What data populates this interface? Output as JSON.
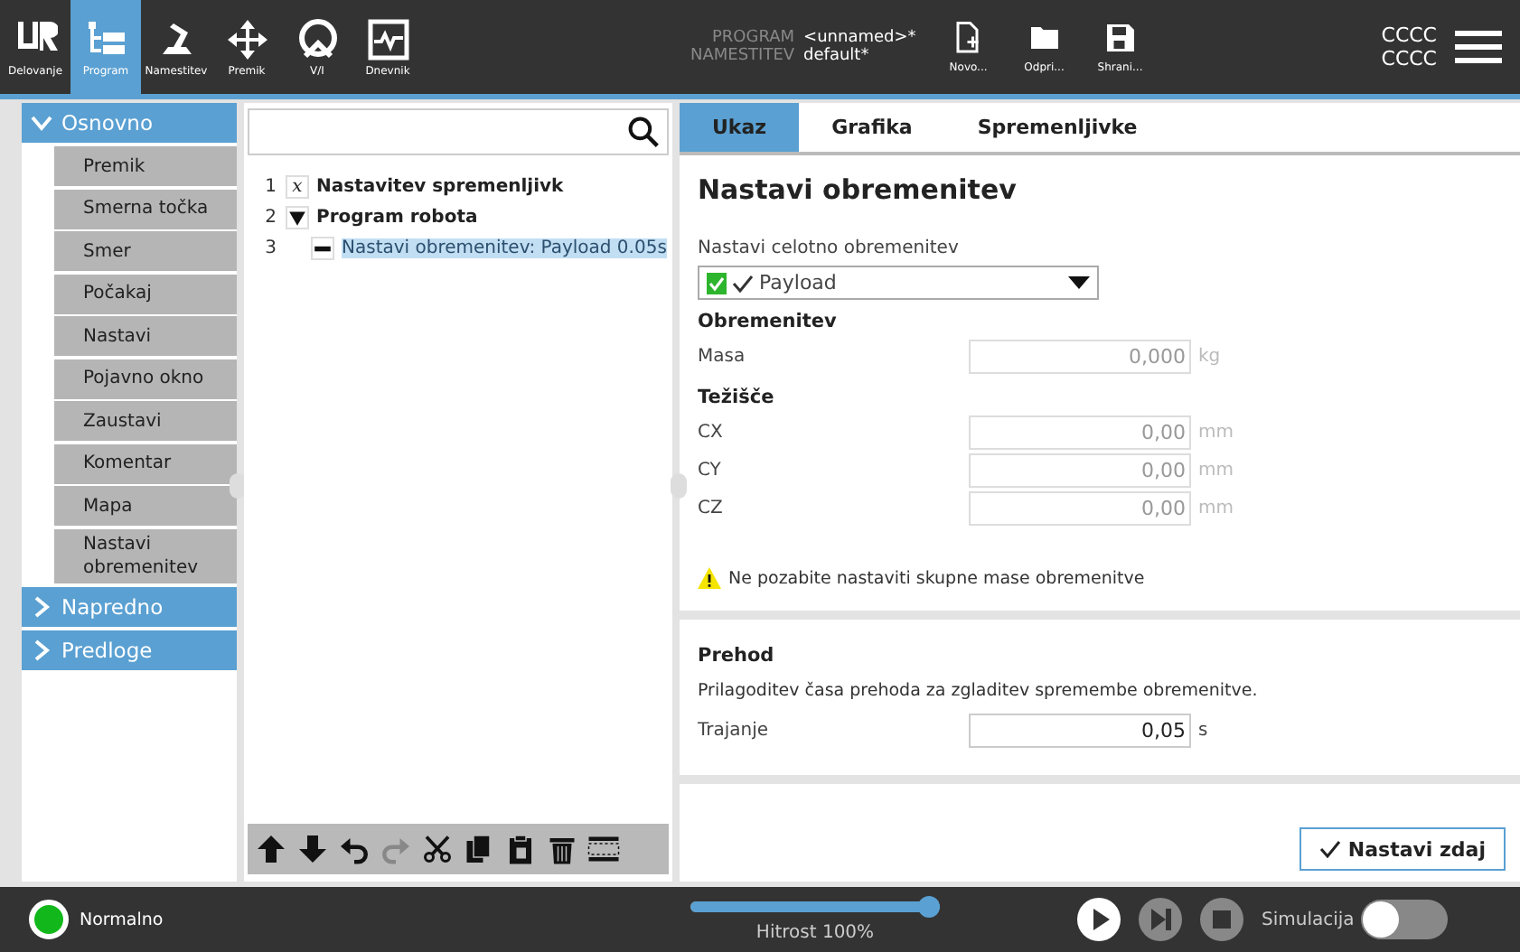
{
  "header": {
    "nav": [
      {
        "label": "Delovanje",
        "selected": false
      },
      {
        "label": "Program",
        "selected": true
      },
      {
        "label": "Namestitev",
        "selected": false
      },
      {
        "label": "Premik",
        "selected": false
      },
      {
        "label": "V/I",
        "selected": false
      },
      {
        "label": "Dnevnik",
        "selected": false
      }
    ],
    "program_label": "PROGRAM",
    "program_name": "<unnamed>*",
    "installation_label": "NAMESTITEV",
    "installation_name": "default*",
    "file_buttons": [
      "Novo...",
      "Odpri...",
      "Shrani..."
    ],
    "user_lines": [
      "CCCC",
      "CCCC"
    ]
  },
  "sidebar": {
    "groups": [
      {
        "label": "Osnovno",
        "expanded": true,
        "items": [
          "Premik",
          "Smerna točka",
          "Smer",
          "Počakaj",
          "Nastavi",
          "Pojavno okno",
          "Zaustavi",
          "Komentar",
          "Mapa",
          "Nastavi obremenitev"
        ]
      },
      {
        "label": "Napredno",
        "expanded": false
      },
      {
        "label": "Predloge",
        "expanded": false
      }
    ]
  },
  "tree": {
    "rows": [
      {
        "number": "1",
        "kind": "variables",
        "icon": "x",
        "label": "Nastavitev spremenljivk",
        "selected": false
      },
      {
        "number": "2",
        "kind": "folder",
        "label": "Program robota",
        "selected": false,
        "expanded": true,
        "children": [
          {
            "number": "3",
            "kind": "command",
            "label": "Nastavi obremenitev: Payload 0.05s",
            "selected": true
          }
        ]
      }
    ]
  },
  "tabs": [
    {
      "label": "Ukaz",
      "selected": true
    },
    {
      "label": "Grafika",
      "selected": false
    },
    {
      "label": "Spremenljivke",
      "selected": false
    }
  ],
  "command": {
    "title": "Nastavi obremenitev",
    "payload_label": "Nastavi celotno obremenitev",
    "payload_value": "Payload",
    "mass_heading": "Obremenitev",
    "mass": {
      "label": "Masa",
      "value": "0,000",
      "unit": "kg",
      "disabled": true
    },
    "cog_heading": "Težišče",
    "cog": [
      {
        "label": "CX",
        "value": "0,00",
        "unit": "mm",
        "disabled": true
      },
      {
        "label": "CY",
        "value": "0,00",
        "unit": "mm",
        "disabled": true
      },
      {
        "label": "CZ",
        "value": "0,00",
        "unit": "mm",
        "disabled": true
      }
    ],
    "warning": "Ne pozabite nastaviti skupne mase obremenitve"
  },
  "transition": {
    "heading": "Prehod",
    "description": "Prilagoditev časa prehoda za zgladitev spremembe obremenitve.",
    "field": {
      "label": "Trajanje",
      "value": "0,05",
      "unit": "s",
      "disabled": false
    }
  },
  "set_now_button": "Nastavi zdaj",
  "footer": {
    "status": "Normalno",
    "speed": {
      "level": 1.0
    },
    "speed_label": "Hitrost 100%",
    "simulation_label": "Simulacija",
    "simulation_on": false
  }
}
